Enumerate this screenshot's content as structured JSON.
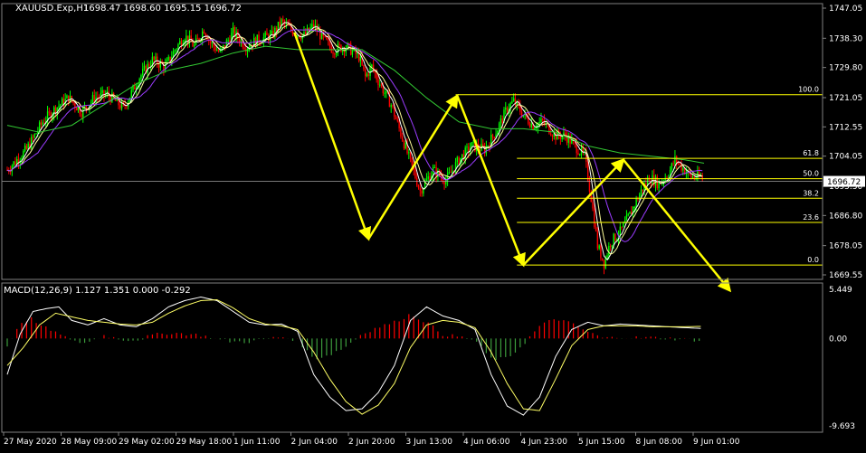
{
  "header": {
    "symbol_label": "XAUUSD.Exp,H1",
    "ohlc_label": "1698.47 1698.60 1695.15 1696.72"
  },
  "price_axis": {
    "ticks": [
      "1747.05",
      "1738.30",
      "1729.80",
      "1721.05",
      "1712.55",
      "1704.05",
      "1695.30",
      "1686.80",
      "1678.05",
      "1669.55"
    ],
    "current_price_label": "1696.72"
  },
  "macd": {
    "label": "MACD(12,26,9) 1.127 1.351 0.000 -0.292",
    "axis_ticks": [
      "5.449",
      "0.00",
      "-9.693"
    ]
  },
  "time_axis": {
    "labels": [
      "27 May 2020",
      "28 May 09:00",
      "29 May 02:00",
      "29 May 18:00",
      "1 Jun 11:00",
      "2 Jun 04:00",
      "2 Jun 20:00",
      "3 Jun 13:00",
      "4 Jun 06:00",
      "4 Jun 23:00",
      "5 Jun 15:00",
      "8 Jun 08:00",
      "9 Jun 01:00"
    ]
  },
  "fibonacci": {
    "levels": [
      {
        "label": "100.0",
        "price": 1721.9
      },
      {
        "label": "61.8",
        "price": 1703.4
      },
      {
        "label": "50.0",
        "price": 1697.5
      },
      {
        "label": "38.2",
        "price": 1691.8
      },
      {
        "label": "23.6",
        "price": 1684.8
      },
      {
        "label": "0.0",
        "price": 1672.4
      }
    ]
  },
  "colors": {
    "background": "#000000",
    "bull": "#00ff00",
    "bear": "#ff0000",
    "hist_pos": "#ff0000",
    "hist_neg": "#3c9c3c",
    "fib": "#ffff00",
    "arrow": "#ffff00",
    "ma_fast": "#ffffff",
    "ma_mid": "#ffff99",
    "ma_slow": "#9b3cff",
    "ma_long": "#32c832",
    "macd_line": "#ffffff",
    "signal_line": "#ffff66",
    "axis_text": "#ffffff",
    "grid": "#808080"
  },
  "chart_data": {
    "type": "candlestick",
    "price_range": [
      1669.55,
      1747.05
    ],
    "macd_range": [
      -9.693,
      5.449
    ],
    "price_path": [
      [
        0,
        1700
      ],
      [
        12,
        1706
      ],
      [
        22,
        1714
      ],
      [
        30,
        1718
      ],
      [
        38,
        1721
      ],
      [
        46,
        1717
      ],
      [
        54,
        1721
      ],
      [
        62,
        1722
      ],
      [
        72,
        1718
      ],
      [
        82,
        1727
      ],
      [
        90,
        1732
      ],
      [
        98,
        1730
      ],
      [
        104,
        1735
      ],
      [
        110,
        1739
      ],
      [
        116,
        1736
      ],
      [
        122,
        1741
      ],
      [
        126,
        1737
      ],
      [
        132,
        1734
      ],
      [
        140,
        1740
      ],
      [
        148,
        1736
      ],
      [
        156,
        1738
      ],
      [
        164,
        1739
      ],
      [
        170,
        1743
      ],
      [
        178,
        1740
      ],
      [
        184,
        1739
      ],
      [
        190,
        1742
      ],
      [
        196,
        1738
      ],
      [
        202,
        1735
      ],
      [
        210,
        1736
      ],
      [
        218,
        1733
      ],
      [
        222,
        1727
      ],
      [
        226,
        1730
      ],
      [
        230,
        1726
      ],
      [
        238,
        1719
      ],
      [
        248,
        1705
      ],
      [
        256,
        1694
      ],
      [
        264,
        1700
      ],
      [
        272,
        1697
      ],
      [
        280,
        1703
      ],
      [
        288,
        1707
      ],
      [
        296,
        1706
      ],
      [
        304,
        1712
      ],
      [
        310,
        1718
      ],
      [
        314,
        1720
      ],
      [
        320,
        1716
      ],
      [
        326,
        1713
      ],
      [
        332,
        1714
      ],
      [
        340,
        1710
      ],
      [
        346,
        1710
      ],
      [
        352,
        1707
      ],
      [
        358,
        1704
      ],
      [
        362,
        1692
      ],
      [
        366,
        1678
      ],
      [
        370,
        1673
      ],
      [
        374,
        1679
      ],
      [
        380,
        1682
      ],
      [
        386,
        1687
      ],
      [
        392,
        1693
      ],
      [
        398,
        1698
      ],
      [
        404,
        1696
      ],
      [
        410,
        1699
      ],
      [
        414,
        1703
      ],
      [
        418,
        1701
      ],
      [
        424,
        1698
      ],
      [
        430,
        1698
      ],
      [
        432,
        1697
      ]
    ],
    "ma_long_path": [
      [
        0,
        1713
      ],
      [
        20,
        1711
      ],
      [
        40,
        1713
      ],
      [
        60,
        1719
      ],
      [
        80,
        1725
      ],
      [
        100,
        1729
      ],
      [
        120,
        1731
      ],
      [
        140,
        1734
      ],
      [
        160,
        1736
      ],
      [
        180,
        1735
      ],
      [
        200,
        1735
      ],
      [
        220,
        1735
      ],
      [
        240,
        1729
      ],
      [
        260,
        1721
      ],
      [
        280,
        1714
      ],
      [
        300,
        1712
      ],
      [
        320,
        1712
      ],
      [
        340,
        1711
      ],
      [
        360,
        1707
      ],
      [
        380,
        1705
      ],
      [
        400,
        1704
      ],
      [
        420,
        1703
      ],
      [
        432,
        1702
      ]
    ],
    "macd_path": [
      [
        0,
        -4.0
      ],
      [
        8,
        0.5
      ],
      [
        16,
        3.0
      ],
      [
        24,
        3.3
      ],
      [
        32,
        3.5
      ],
      [
        40,
        2.0
      ],
      [
        50,
        1.5
      ],
      [
        60,
        2.2
      ],
      [
        70,
        1.5
      ],
      [
        80,
        1.3
      ],
      [
        90,
        2.2
      ],
      [
        100,
        3.5
      ],
      [
        110,
        4.2
      ],
      [
        120,
        4.6
      ],
      [
        130,
        4.2
      ],
      [
        140,
        3.0
      ],
      [
        150,
        1.8
      ],
      [
        160,
        1.5
      ],
      [
        170,
        1.6
      ],
      [
        180,
        0.8
      ],
      [
        190,
        -4.0
      ],
      [
        200,
        -6.5
      ],
      [
        210,
        -8.0
      ],
      [
        220,
        -7.8
      ],
      [
        230,
        -6.0
      ],
      [
        240,
        -3.0
      ],
      [
        250,
        2.0
      ],
      [
        260,
        3.5
      ],
      [
        270,
        2.5
      ],
      [
        280,
        2.0
      ],
      [
        290,
        1.0
      ],
      [
        300,
        -4.0
      ],
      [
        310,
        -7.5
      ],
      [
        320,
        -8.5
      ],
      [
        330,
        -6.5
      ],
      [
        340,
        -2.0
      ],
      [
        350,
        1.0
      ],
      [
        360,
        1.8
      ],
      [
        370,
        1.4
      ],
      [
        380,
        1.6
      ],
      [
        390,
        1.5
      ],
      [
        400,
        1.4
      ],
      [
        410,
        1.3
      ],
      [
        420,
        1.2
      ],
      [
        432,
        1.1
      ]
    ],
    "signal_path": [
      [
        0,
        -3.0
      ],
      [
        10,
        -1.0
      ],
      [
        20,
        1.5
      ],
      [
        30,
        2.8
      ],
      [
        40,
        2.4
      ],
      [
        50,
        2.0
      ],
      [
        60,
        1.8
      ],
      [
        70,
        1.6
      ],
      [
        80,
        1.5
      ],
      [
        90,
        1.8
      ],
      [
        100,
        2.8
      ],
      [
        110,
        3.6
      ],
      [
        120,
        4.2
      ],
      [
        130,
        4.3
      ],
      [
        140,
        3.4
      ],
      [
        150,
        2.2
      ],
      [
        160,
        1.6
      ],
      [
        170,
        1.4
      ],
      [
        180,
        1.0
      ],
      [
        190,
        -1.5
      ],
      [
        200,
        -4.5
      ],
      [
        210,
        -7.0
      ],
      [
        220,
        -8.4
      ],
      [
        230,
        -7.4
      ],
      [
        240,
        -5.0
      ],
      [
        250,
        -1.0
      ],
      [
        260,
        1.5
      ],
      [
        270,
        2.0
      ],
      [
        280,
        1.8
      ],
      [
        290,
        1.2
      ],
      [
        300,
        -1.5
      ],
      [
        310,
        -5.0
      ],
      [
        320,
        -7.8
      ],
      [
        330,
        -8.0
      ],
      [
        340,
        -4.5
      ],
      [
        350,
        -0.8
      ],
      [
        360,
        1.0
      ],
      [
        370,
        1.4
      ],
      [
        380,
        1.4
      ],
      [
        390,
        1.4
      ],
      [
        400,
        1.3
      ],
      [
        410,
        1.3
      ],
      [
        420,
        1.3
      ],
      [
        432,
        1.35
      ]
    ],
    "annotation_arrows": [
      {
        "from": [
          178,
          1740
        ],
        "to": [
          224,
          1680
        ]
      },
      {
        "from": [
          224,
          1680
        ],
        "to": [
          279,
          1721.6
        ]
      },
      {
        "from": [
          279,
          1721.6
        ],
        "to": [
          320,
          1672.4
        ]
      },
      {
        "from": [
          320,
          1672.4
        ],
        "to": [
          382,
          1703
        ]
      },
      {
        "from": [
          382,
          1703
        ],
        "to": [
          448,
          1665
        ]
      }
    ]
  }
}
